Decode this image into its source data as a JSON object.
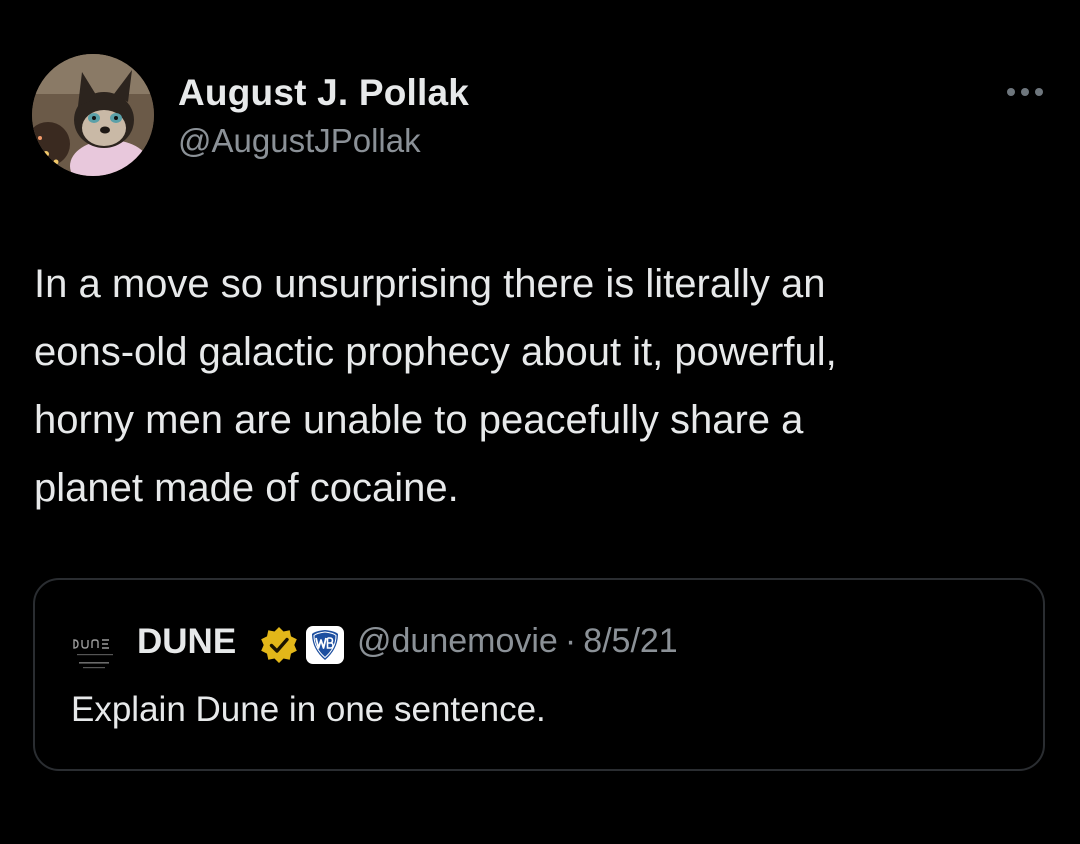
{
  "author": {
    "name": "August J. Pollak",
    "handle": "@AugustJPollak",
    "avatar_icon": "cat-avatar"
  },
  "tweet": {
    "text_lines": [
      "In a move so unsurprising there is literally an",
      "eons-old galactic prophecy about it, powerful,",
      "horny men are unable to peacefully share a",
      "planet made of cocaine."
    ]
  },
  "more_icon": "ellipsis-icon",
  "quoted_tweet": {
    "avatar_icon": "dune-logo",
    "name": "DUNE",
    "verified_icon": "gold-verified-badge-icon",
    "affiliate_icon": "warner-bros-badge-icon",
    "handle": "@dunemovie",
    "separator": "·",
    "date": "8/5/21",
    "text": "Explain Dune in one sentence."
  },
  "colors": {
    "background": "#000000",
    "primary_text": "#e7e9ea",
    "secondary_text": "#8b9197",
    "card_border": "#2a2d31",
    "verified_gold": "#e2b719",
    "wb_blue": "#1d4fa0"
  }
}
